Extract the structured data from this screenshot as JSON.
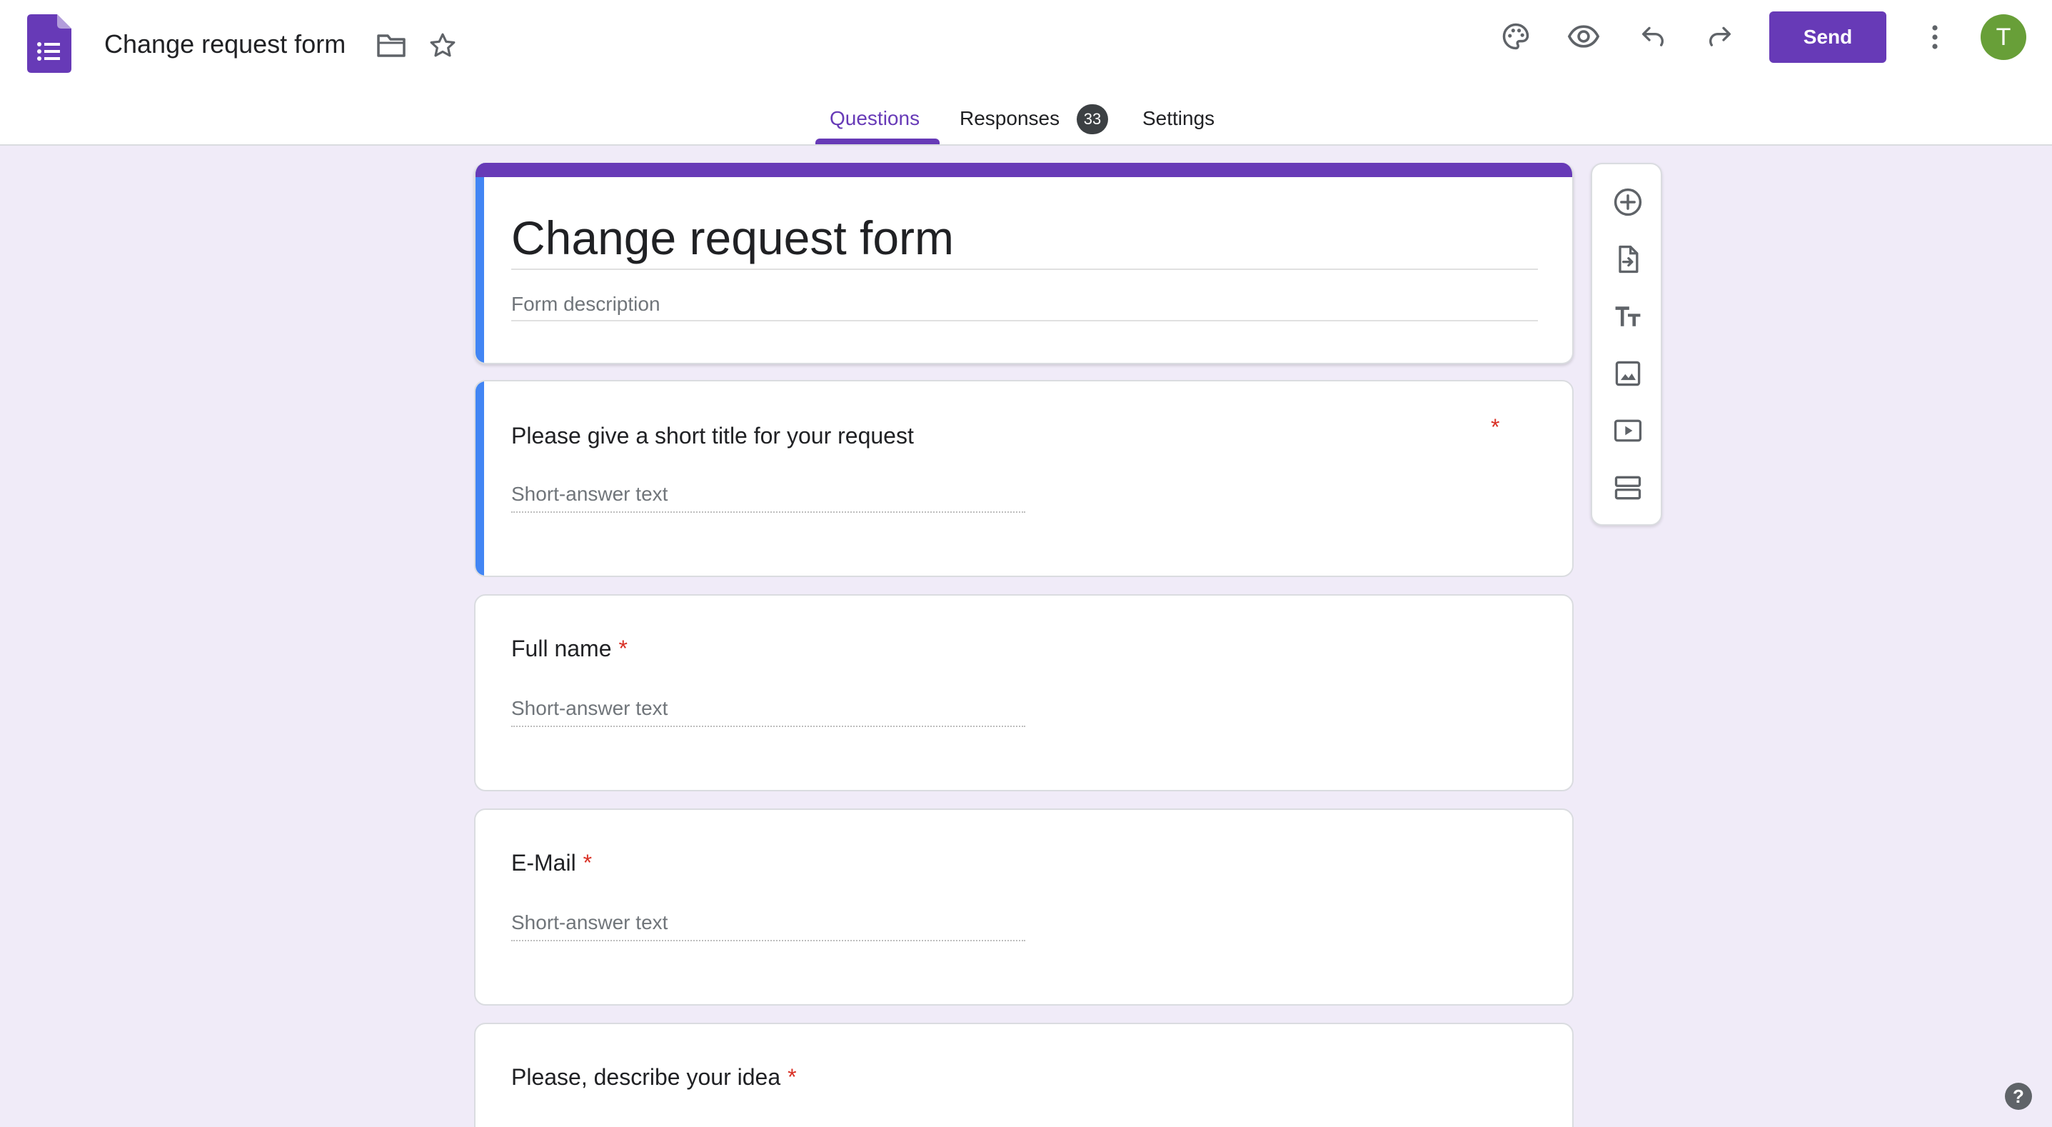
{
  "header": {
    "title": "Change request form",
    "send_label": "Send",
    "avatar_initial": "T"
  },
  "tabs": [
    {
      "label": "Questions",
      "active": true
    },
    {
      "label": "Responses",
      "badge": "33"
    },
    {
      "label": "Settings"
    }
  ],
  "form": {
    "title": "Change request form",
    "description_placeholder": "Form description",
    "questions": [
      {
        "title": "Please give a short title for your request",
        "required_mark": "*",
        "answer_placeholder": "Short-answer text"
      },
      {
        "title": "Full name",
        "required_mark": "*",
        "answer_placeholder": "Short-answer text"
      },
      {
        "title": "E-Mail",
        "required_mark": "*",
        "answer_placeholder": "Short-answer text"
      },
      {
        "title": "Please, describe your idea",
        "required_mark": "*"
      }
    ]
  },
  "help_label": "?",
  "colors": {
    "brand": "#673ab7",
    "background": "#f0ebf8",
    "active_indicator": "#4285f4",
    "required": "#d93025",
    "avatar": "#689f38"
  },
  "icons": {
    "header": [
      "forms-logo-icon",
      "folder-icon",
      "star-icon",
      "palette-icon",
      "preview-eye-icon",
      "undo-icon",
      "redo-icon",
      "more-vert-icon"
    ],
    "toolbar": [
      "add-question-icon",
      "import-questions-icon",
      "add-title-icon",
      "add-image-icon",
      "add-video-icon",
      "add-section-icon"
    ]
  }
}
